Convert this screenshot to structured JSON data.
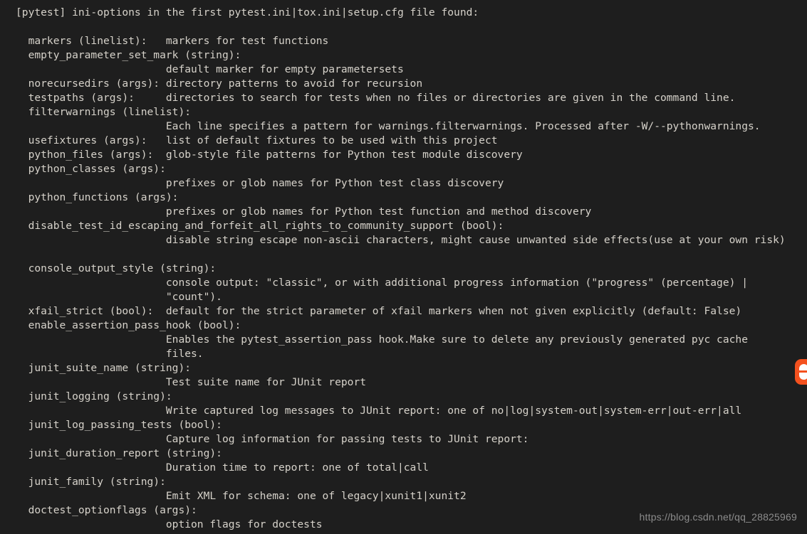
{
  "terminal": {
    "background_color": "#1e1e1e",
    "text_color": "#d6d2ca",
    "header": "[pytest] ini-options in the first pytest.ini|tox.ini|setup.cfg file found:",
    "lines": [
      "[pytest] ini-options in the first pytest.ini|tox.ini|setup.cfg file found:",
      "",
      "  markers (linelist):   markers for test functions",
      "  empty_parameter_set_mark (string):",
      "                        default marker for empty parametersets",
      "  norecursedirs (args): directory patterns to avoid for recursion",
      "  testpaths (args):     directories to search for tests when no files or directories are given in the command line.",
      "  filterwarnings (linelist):",
      "                        Each line specifies a pattern for warnings.filterwarnings. Processed after -W/--pythonwarnings.",
      "  usefixtures (args):   list of default fixtures to be used with this project",
      "  python_files (args):  glob-style file patterns for Python test module discovery",
      "  python_classes (args):",
      "                        prefixes or glob names for Python test class discovery",
      "  python_functions (args):",
      "                        prefixes or glob names for Python test function and method discovery",
      "  disable_test_id_escaping_and_forfeit_all_rights_to_community_support (bool):",
      "                        disable string escape non-ascii characters, might cause unwanted side effects(use at your own risk)",
      "",
      "  console_output_style (string):",
      "                        console output: \"classic\", or with additional progress information (\"progress\" (percentage) |",
      "                        \"count\").",
      "  xfail_strict (bool):  default for the strict parameter of xfail markers when not given explicitly (default: False)",
      "  enable_assertion_pass_hook (bool):",
      "                        Enables the pytest_assertion_pass hook.Make sure to delete any previously generated pyc cache",
      "                        files.",
      "  junit_suite_name (string):",
      "                        Test suite name for JUnit report",
      "  junit_logging (string):",
      "                        Write captured log messages to JUnit report: one of no|log|system-out|system-err|out-err|all",
      "  junit_log_passing_tests (bool):",
      "                        Capture log information for passing tests to JUnit report:",
      "  junit_duration_report (string):",
      "                        Duration time to report: one of total|call",
      "  junit_family (string):",
      "                        Emit XML for schema: one of legacy|xunit1|xunit2",
      "  doctest_optionflags (args):",
      "                        option flags for doctests"
    ],
    "options": [
      {
        "name": "markers",
        "type": "linelist",
        "description": "markers for test functions"
      },
      {
        "name": "empty_parameter_set_mark",
        "type": "string",
        "description": "default marker for empty parametersets"
      },
      {
        "name": "norecursedirs",
        "type": "args",
        "description": "directory patterns to avoid for recursion"
      },
      {
        "name": "testpaths",
        "type": "args",
        "description": "directories to search for tests when no files or directories are given in the command line."
      },
      {
        "name": "filterwarnings",
        "type": "linelist",
        "description": "Each line specifies a pattern for warnings.filterwarnings. Processed after -W/--pythonwarnings."
      },
      {
        "name": "usefixtures",
        "type": "args",
        "description": "list of default fixtures to be used with this project"
      },
      {
        "name": "python_files",
        "type": "args",
        "description": "glob-style file patterns for Python test module discovery"
      },
      {
        "name": "python_classes",
        "type": "args",
        "description": "prefixes or glob names for Python test class discovery"
      },
      {
        "name": "python_functions",
        "type": "args",
        "description": "prefixes or glob names for Python test function and method discovery"
      },
      {
        "name": "disable_test_id_escaping_and_forfeit_all_rights_to_community_support",
        "type": "bool",
        "description": "disable string escape non-ascii characters, might cause unwanted side effects(use at your own risk)"
      },
      {
        "name": "console_output_style",
        "type": "string",
        "description": "console output: \"classic\", or with additional progress information (\"progress\" (percentage) | \"count\")."
      },
      {
        "name": "xfail_strict",
        "type": "bool",
        "description": "default for the strict parameter of xfail markers when not given explicitly (default: False)"
      },
      {
        "name": "enable_assertion_pass_hook",
        "type": "bool",
        "description": "Enables the pytest_assertion_pass hook.Make sure to delete any previously generated pyc cache files."
      },
      {
        "name": "junit_suite_name",
        "type": "string",
        "description": "Test suite name for JUnit report"
      },
      {
        "name": "junit_logging",
        "type": "string",
        "description": "Write captured log messages to JUnit report: one of no|log|system-out|system-err|out-err|all"
      },
      {
        "name": "junit_log_passing_tests",
        "type": "bool",
        "description": "Capture log information for passing tests to JUnit report:"
      },
      {
        "name": "junit_duration_report",
        "type": "string",
        "description": "Duration time to report: one of total|call"
      },
      {
        "name": "junit_family",
        "type": "string",
        "description": "Emit XML for schema: one of legacy|xunit1|xunit2"
      },
      {
        "name": "doctest_optionflags",
        "type": "args",
        "description": "option flags for doctests"
      }
    ]
  },
  "watermark": {
    "text": "https://blog.csdn.net/qq_28825969",
    "color": "#8c8c8c"
  },
  "edge_icon": {
    "name": "orange-app-icon",
    "color": "#f4511e"
  }
}
